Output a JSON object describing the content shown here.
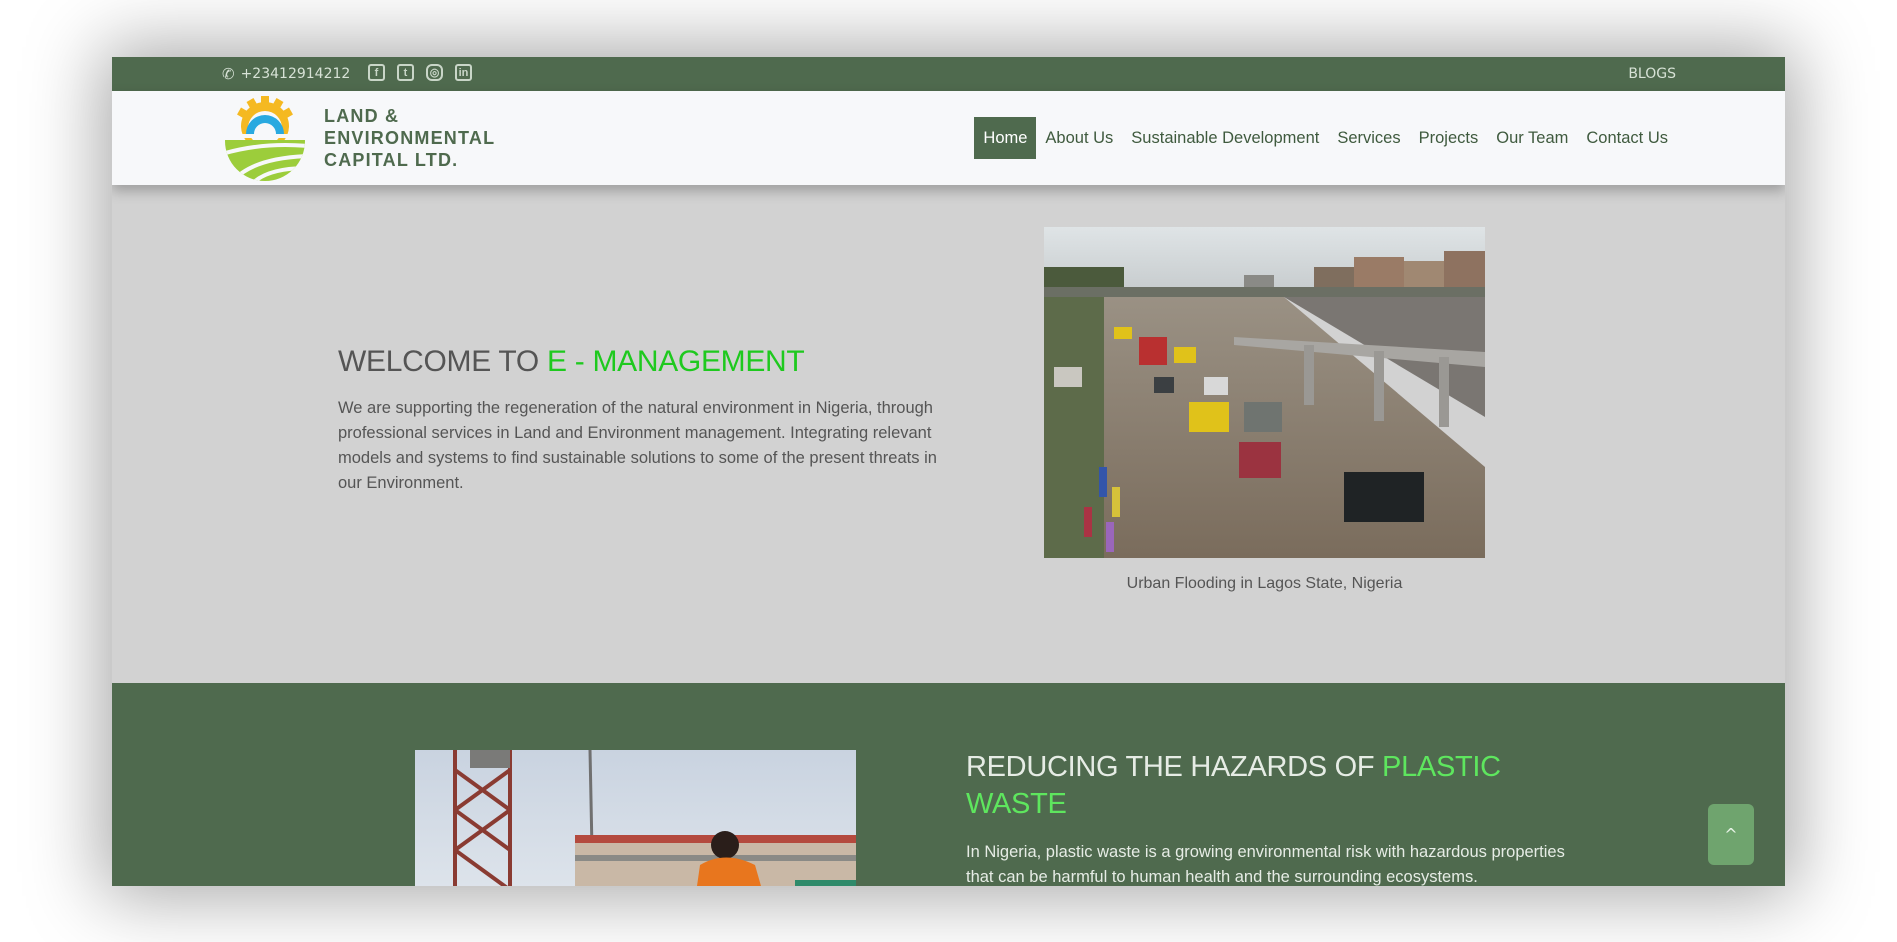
{
  "topbar": {
    "phone_icon": "phone-icon",
    "phone": "+23412914212",
    "socials": [
      {
        "name": "facebook-icon",
        "glyph": "f"
      },
      {
        "name": "twitter-icon",
        "glyph": "t"
      },
      {
        "name": "instagram-icon",
        "glyph": "◎"
      },
      {
        "name": "linkedin-icon",
        "glyph": "in"
      }
    ],
    "blogs_label": "BLOGS"
  },
  "header": {
    "logo_lines": [
      "LAND &",
      "ENVIRONMENTAL",
      "CAPITAL LTD."
    ],
    "nav": [
      {
        "label": "Home",
        "active": true
      },
      {
        "label": "About Us"
      },
      {
        "label": "Sustainable Development"
      },
      {
        "label": "Services"
      },
      {
        "label": "Projects"
      },
      {
        "label": "Our Team"
      },
      {
        "label": "Contact Us"
      }
    ]
  },
  "hero": {
    "title_prefix": "WELCOME TO ",
    "title_accent": "E - MANAGEMENT",
    "body": "We are supporting the regeneration of the natural environment in Nigeria, through professional services in Land and Environment management. Integrating relevant models and systems to find sustainable solutions to some of the present threats in our Environment.",
    "caption": "Urban Flooding in Lagos State, Nigeria"
  },
  "plastic": {
    "title_prefix": "REDUCING THE HAZARDS OF ",
    "title_accent": "PLASTIC WASTE",
    "body": "In Nigeria, plastic waste is a growing environmental risk with hazardous properties that can be harmful to human health and the surrounding ecosystems."
  },
  "back_to_top": {
    "icon": "chevron-up-icon",
    "glyph": "^"
  },
  "colors": {
    "brand_green": "#4f6a4e",
    "accent_green": "#1ec91e",
    "light_accent": "#5ee65e",
    "logo_yellow": "#f5b921",
    "logo_blue": "#29a9e0",
    "logo_lime": "#9ccd3b"
  }
}
